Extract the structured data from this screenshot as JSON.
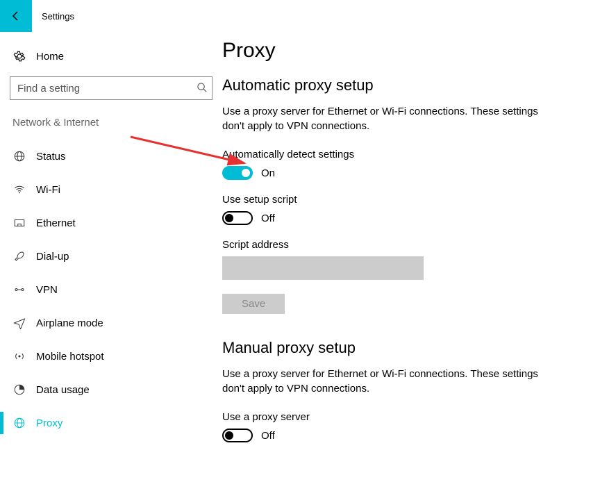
{
  "app_title": "Settings",
  "sidebar": {
    "home": "Home",
    "search_placeholder": "Find a setting",
    "section": "Network & Internet",
    "items": [
      {
        "label": "Status"
      },
      {
        "label": "Wi-Fi"
      },
      {
        "label": "Ethernet"
      },
      {
        "label": "Dial-up"
      },
      {
        "label": "VPN"
      },
      {
        "label": "Airplane mode"
      },
      {
        "label": "Mobile hotspot"
      },
      {
        "label": "Data usage"
      },
      {
        "label": "Proxy"
      }
    ]
  },
  "content": {
    "page_title": "Proxy",
    "auto": {
      "heading": "Automatic proxy setup",
      "desc": "Use a proxy server for Ethernet or Wi-Fi connections. These settings don't apply to VPN connections.",
      "detect_label": "Automatically detect settings",
      "detect_state": "On",
      "script_label": "Use setup script",
      "script_state": "Off",
      "script_addr_label": "Script address",
      "script_addr_value": "",
      "save_label": "Save"
    },
    "manual": {
      "heading": "Manual proxy setup",
      "desc": "Use a proxy server for Ethernet or Wi-Fi connections. These settings don't apply to VPN connections.",
      "use_label": "Use a proxy server",
      "use_state": "Off"
    }
  }
}
